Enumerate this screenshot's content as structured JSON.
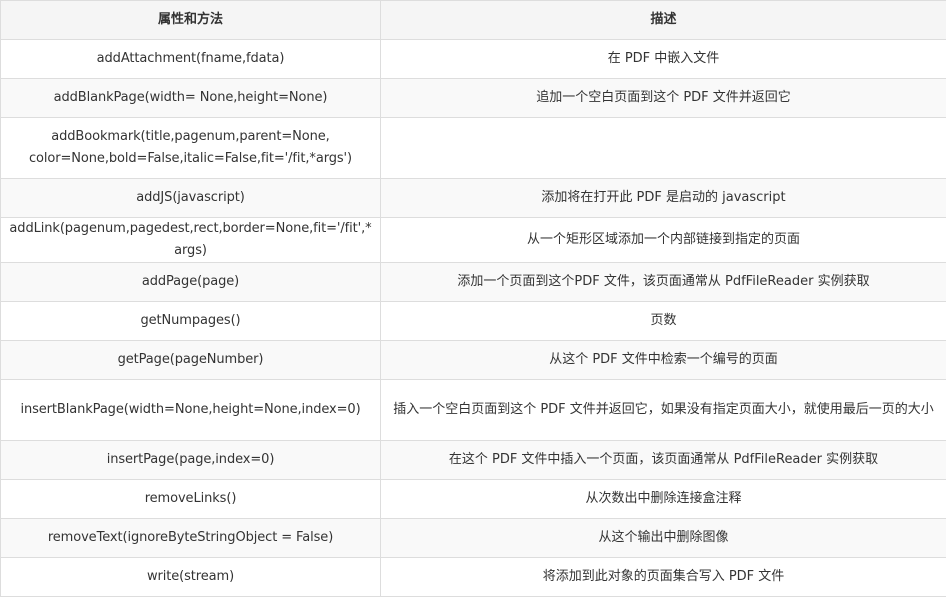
{
  "table": {
    "headers": [
      "属性和方法",
      "描述"
    ],
    "rows": [
      {
        "method": "addAttachment(fname,fdata)",
        "desc": "在 PDF 中嵌入文件"
      },
      {
        "method": "addBlankPage(width= None,height=None)",
        "desc": "追加一个空白页面到这个 PDF 文件并返回它"
      },
      {
        "method": "addBookmark(title,pagenum,parent=None, color=None,bold=False,italic=False,fit='/fit,*args')",
        "desc": ""
      },
      {
        "method": "addJS(javascript)",
        "desc": "添加将在打开此 PDF 是启动的 javascript"
      },
      {
        "method": "addLink(pagenum,pagedest,rect,border=None,fit='/fit',*args)",
        "desc": "从一个矩形区域添加一个内部链接到指定的页面"
      },
      {
        "method": "addPage(page)",
        "desc": "添加一个页面到这个PDF 文件，该页面通常从 PdfFileReader 实例获取"
      },
      {
        "method": "getNumpages()",
        "desc": "页数"
      },
      {
        "method": "getPage(pageNumber)",
        "desc": "从这个 PDF 文件中检索一个编号的页面"
      },
      {
        "method": "insertBlankPage(width=None,height=None,index=0)",
        "desc": "插入一个空白页面到这个 PDF 文件并返回它，如果没有指定页面大小，就使用最后一页的大小"
      },
      {
        "method": "insertPage(page,index=0)",
        "desc": "在这个 PDF 文件中插入一个页面，该页面通常从 PdfFileReader 实例获取"
      },
      {
        "method": "removeLinks()",
        "desc": "从次数出中删除连接盒注释"
      },
      {
        "method": "removeText(ignoreByteStringObject = False)",
        "desc": "从这个输出中删除图像"
      },
      {
        "method": "write(stream)",
        "desc": "将添加到此对象的页面集合写入 PDF 文件"
      }
    ]
  }
}
